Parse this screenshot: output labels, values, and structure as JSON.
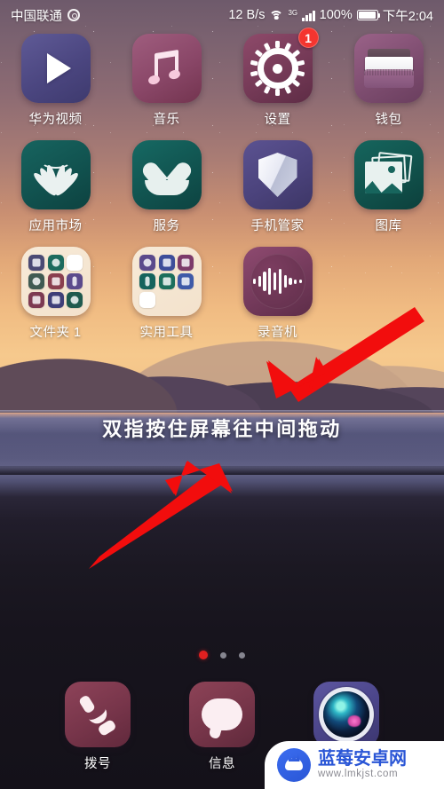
{
  "status_bar": {
    "carrier": "中国联通",
    "carrier_icon": "gear-icon",
    "network_speed": "12 B/s",
    "wifi_icon": "wifi-icon",
    "mobile_network": "3G",
    "signal_icon": "signal-bars-icon",
    "battery_percent": "100%",
    "battery_icon": "battery-full-icon",
    "time": "下午2:04"
  },
  "home_screen": {
    "apps": [
      {
        "label": "华为视频",
        "icon": "video-play-icon",
        "bg": "#4b4680",
        "badge": null
      },
      {
        "label": "音乐",
        "icon": "music-note-icon",
        "bg": "#8a4768",
        "badge": null
      },
      {
        "label": "设置",
        "icon": "gear-icon",
        "bg": "#753a57",
        "badge": "1"
      },
      {
        "label": "钱包",
        "icon": "wallet-icon",
        "bg": "#7e4d70",
        "badge": null
      },
      {
        "label": "应用市场",
        "icon": "huawei-flower-icon",
        "bg": "#11524f",
        "badge": null
      },
      {
        "label": "服务",
        "icon": "heart-in-hand-icon",
        "bg": "#115450",
        "badge": null
      },
      {
        "label": "手机管家",
        "icon": "shield-icon",
        "bg": "#4b437c",
        "badge": null
      },
      {
        "label": "图库",
        "icon": "photo-stack-icon",
        "bg": "#11524c",
        "badge": null
      },
      {
        "label": "文件夹 1",
        "icon": "folder-icon",
        "bg": "#f3e2cc",
        "badge": null
      },
      {
        "label": "实用工具",
        "icon": "folder-icon",
        "bg": "#f3e2cc",
        "badge": null
      },
      {
        "label": "录音机",
        "icon": "waveform-icon",
        "bg": "#743a5b",
        "badge": null
      }
    ],
    "folder1_mini_colors": [
      "#4b4a74",
      "#1d6b5e",
      "#ffffff",
      "#3f5a52",
      "#8a3f4f",
      "#5b4a8c",
      "#7d3a52",
      "#3f3f78",
      "#1f5a4e"
    ],
    "folder2_mini_colors": [
      "#5b4a8c",
      "#3e4e9a",
      "#7d3a6a",
      "#15635d",
      "#1c6f5c",
      "#3f5aa8",
      "#ffffff"
    ],
    "instruction_text": "双指按住屏幕往中间拖动",
    "page_indicator": {
      "total": 3,
      "active_index": 0,
      "active_color": "#e02020",
      "inactive_color": "#9a9aa4"
    }
  },
  "dock": {
    "apps": [
      {
        "label": "拨号",
        "icon": "phone-icon",
        "bg": "#77354a"
      },
      {
        "label": "信息",
        "icon": "speech-bubble-icon",
        "bg": "#763549"
      },
      {
        "label": "",
        "icon": "camera-icon",
        "bg": "#4a4488"
      }
    ]
  },
  "annotations": {
    "arrow1": {
      "name": "red-arrow-to-banner",
      "color": "#f20d0d"
    },
    "arrow2": {
      "name": "red-arrow-from-bottom",
      "color": "#f20d0d"
    }
  },
  "watermark": {
    "title": "蓝莓安卓网",
    "url": "www.lmkjst.com",
    "logo_icon": "android-robot-icon",
    "brand_color": "#2a56d6"
  }
}
